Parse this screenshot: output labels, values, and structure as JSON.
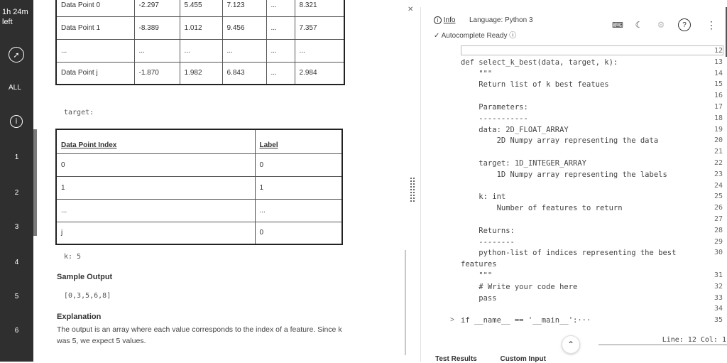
{
  "sidebar": {
    "time_line1": "1h 24m",
    "time_line2": "left",
    "all_label": "ALL",
    "questions": [
      "1",
      "2",
      "3",
      "4",
      "5",
      "6"
    ]
  },
  "problem": {
    "data_rows": [
      [
        "Data Point 0",
        "-2.297",
        "5.455",
        "7.123",
        "...",
        "8.321"
      ],
      [
        "Data Point 1",
        "-8.389",
        "1.012",
        "9.456",
        "...",
        "7.357"
      ],
      [
        "...",
        "...",
        "...",
        "...",
        "...",
        "..."
      ],
      [
        "Data Point j",
        "-1.870",
        "1.982",
        "6.843",
        "...",
        "2.984"
      ]
    ],
    "target_label": "target:",
    "label_headers": [
      "Data Point Index",
      "Label"
    ],
    "label_rows": [
      [
        "0",
        "0"
      ],
      [
        "1",
        "1"
      ],
      [
        "...",
        "..."
      ],
      [
        "j",
        "0"
      ]
    ],
    "k_line": "k: 5",
    "sample_output_heading": "Sample Output",
    "sample_output": "[0,3,5,6,8]",
    "explanation_heading": "Explanation",
    "explanation_line1": "The output is an array where each value corresponds to the index of a feature. Since k",
    "explanation_line2": "was 5, we expect 5 values."
  },
  "editor": {
    "info_label": "Info",
    "language": "Language: Python 3",
    "autocomplete": "Autocomplete Ready",
    "lines": [
      {
        "n": "12",
        "code": ""
      },
      {
        "n": "13",
        "code": "def select_k_best(data, target, k):"
      },
      {
        "n": "14",
        "code": "    \"\"\""
      },
      {
        "n": "15",
        "code": "    Return list of k best featues"
      },
      {
        "n": "16",
        "code": ""
      },
      {
        "n": "17",
        "code": "    Parameters:"
      },
      {
        "n": "18",
        "code": "    -----------"
      },
      {
        "n": "19",
        "code": "    data: 2D_FLOAT_ARRAY"
      },
      {
        "n": "20",
        "code": "        2D Numpy array representing the data"
      },
      {
        "n": "21",
        "code": ""
      },
      {
        "n": "22",
        "code": "    target: 1D_INTEGER_ARRAY"
      },
      {
        "n": "23",
        "code": "        1D Numpy array representing the labels"
      },
      {
        "n": "24",
        "code": ""
      },
      {
        "n": "25",
        "code": "    k: int"
      },
      {
        "n": "26",
        "code": "        Number of features to return"
      },
      {
        "n": "27",
        "code": ""
      },
      {
        "n": "28",
        "code": "    Returns:"
      },
      {
        "n": "29",
        "code": "    --------"
      },
      {
        "n": "30",
        "code": "    python-list of indices representing the best"
      },
      {
        "n": "",
        "code": "features"
      },
      {
        "n": "31",
        "code": "    \"\"\""
      },
      {
        "n": "32",
        "code": "    # Write your code here"
      },
      {
        "n": "33",
        "code": "    pass"
      },
      {
        "n": "34",
        "code": ""
      },
      {
        "n": "35",
        "code": "if __name__ == '__main__':···"
      }
    ],
    "status": "Line: 12 Col: 1",
    "bottom_tab_1": "Test Results",
    "bottom_tab_2": "Custom Input"
  }
}
